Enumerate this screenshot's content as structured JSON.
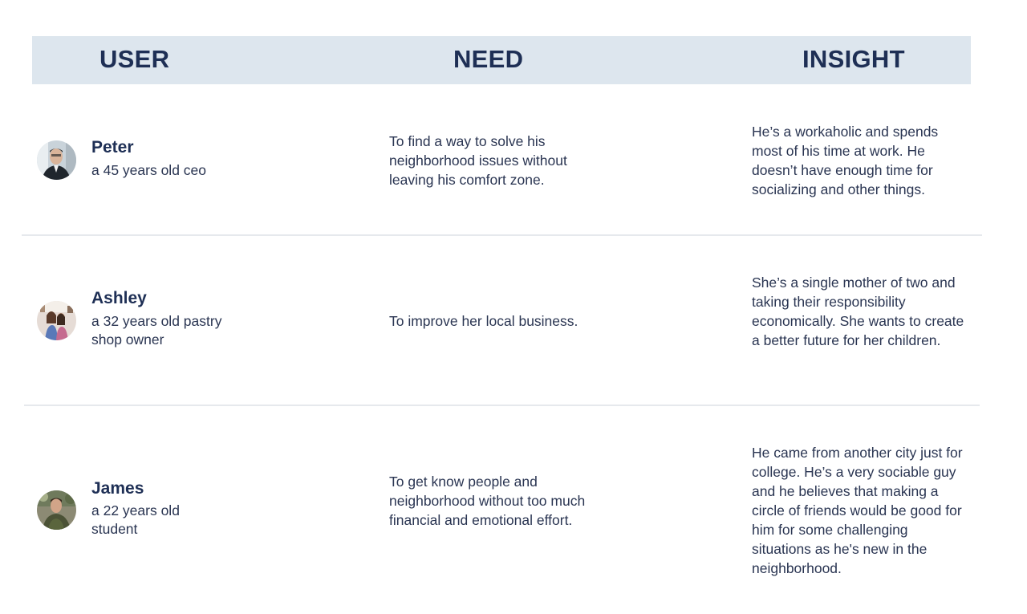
{
  "header": {
    "user": "USER",
    "need": "NEED",
    "insight": "INSIGHT"
  },
  "rows": [
    {
      "name": "Peter",
      "description": "a 45 years old ceo",
      "avatar": "peter-avatar",
      "need": "To find a way to solve his neighborhood issues without leaving his comfort zone.",
      "insight": "He’s a workaholic and spends most of his time at work. He doesn’t have enough time for socializing and other things."
    },
    {
      "name": "Ashley",
      "description": "a 32 years old pastry shop owner",
      "avatar": "ashley-avatar",
      "need": "To improve her local business.",
      "insight": "She’s a single mother of two and taking their responsibility economically. She wants to create a better future for her children."
    },
    {
      "name": "James",
      "description": "a 22 years old student",
      "avatar": "james-avatar",
      "need": "To get know people and neighborhood without too much financial and emotional effort.",
      "insight": "He came from another city just for college. He’s a very sociable guy and he believes that making a circle of friends would be good for him for some challenging situations as he's new in the neighborhood."
    }
  ],
  "colors": {
    "header_bg": "#dde6ee",
    "header_text": "#1e2f55",
    "body_text": "#2a3552",
    "divider": "#e6e9ed"
  }
}
